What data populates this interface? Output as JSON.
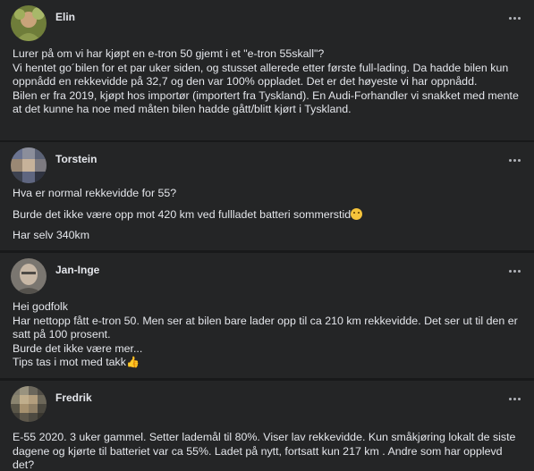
{
  "posts": [
    {
      "author": "Elin",
      "paragraphs": [
        "Lurer på om vi har kjøpt en e-tron 50 gjemt i et \"e-tron 55skall\"?",
        "Vi hentet go´bilen for et par uker siden, og stusset allerede etter første full-lading. Da hadde bilen kun oppnådd en rekkevidde på 32,7 og den var 100% oppladet. Det er det høyeste vi har oppnådd.",
        "Bilen er fra 2019, kjøpt hos importør (importert fra Tyskland). En Audi-Forhandler vi snakket med mente at det kunne ha noe med måten bilen hadde gått/blitt kjørt i Tyskland."
      ]
    },
    {
      "author": "Torstein",
      "paragraphs": [
        "Hva er normal rekkevidde for 55?",
        "Burde det ikke være opp mot 420 km ved fullladet batteri sommerstid",
        "Har selv 340km"
      ],
      "emoji": "smiling-face-emoji"
    },
    {
      "author": "Jan-Inge",
      "paragraphs": [
        "Hei godfolk",
        "Har nettopp fått e-tron 50. Men ser at bilen bare lader opp til ca 210 km rekkevidde. Det ser ut til den er satt på 100 prosent.",
        "Burde det ikke være mer...",
        "Tips tas i mot med takk"
      ],
      "emoji": "thumbs-up-emoji"
    },
    {
      "author": "Fredrik",
      "paragraphs": [
        "E-55 2020. 3 uker gammel. Setter lademål til 80%. Viser lav rekkevidde. Kun småkjøring lokalt de siste dagene og kjørte til batteriet var ca 55%. Ladet på nytt, fortsatt kun 217 km . Andre som har opplevd det?"
      ]
    }
  ],
  "colors": {
    "background": "#18191a",
    "card": "#242526",
    "text": "#e4e6eb",
    "muted": "#b0b3b8"
  }
}
